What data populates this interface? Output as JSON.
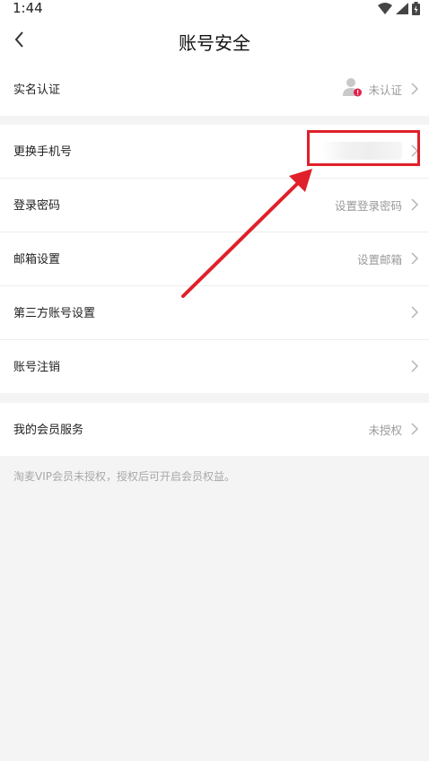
{
  "status_bar": {
    "time": "1:44"
  },
  "nav": {
    "title": "账号安全"
  },
  "rows": {
    "real_name": {
      "label": "实名认证",
      "value": "未认证"
    },
    "phone": {
      "label": "更换手机号",
      "value": ""
    },
    "password": {
      "label": "登录密码",
      "value": "设置登录密码"
    },
    "email": {
      "label": "邮箱设置",
      "value": "设置邮箱"
    },
    "third_party": {
      "label": "第三方账号设置",
      "value": ""
    },
    "cancel": {
      "label": "账号注销",
      "value": ""
    },
    "membership": {
      "label": "我的会员服务",
      "value": "未授权"
    }
  },
  "note": "淘麦VIP会员未授权，授权后可开启会员权益。",
  "colors": {
    "annotation": "#e0202a",
    "badge": "#e5204a"
  }
}
